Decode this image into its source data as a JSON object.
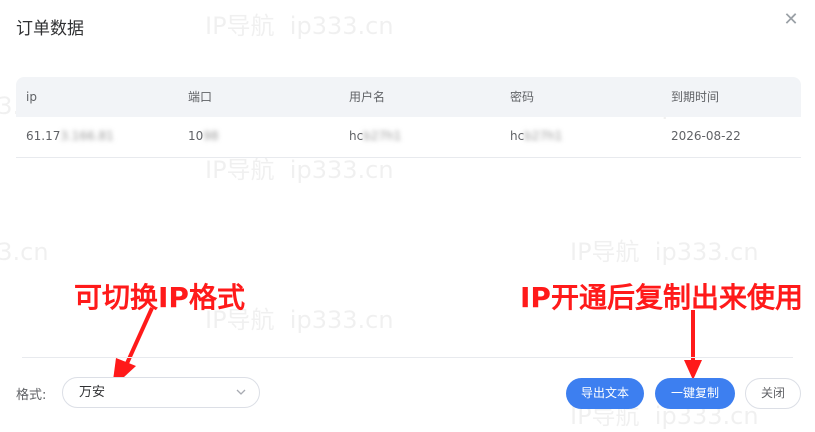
{
  "dialog": {
    "title": "订单数据",
    "close_icon": "close-icon"
  },
  "table": {
    "headers": [
      "ip",
      "端口",
      "用户名",
      "密码",
      "到期时间"
    ],
    "rows": [
      {
        "ip_visible": "61.17",
        "ip_blurred": "3.166.81",
        "port_visible": "10",
        "port_blurred": "98",
        "user_visible": "hc",
        "user_blurred": "b27h1",
        "pass_visible": "hc",
        "pass_blurred": "b27h1",
        "expiry": "2026-08-22"
      }
    ]
  },
  "watermark_text": "IP导航  ip333.cn",
  "annotations": {
    "left": "可切换IP格式",
    "right": "IP开通后复制出来使用",
    "color": "#ff1a1a"
  },
  "footer": {
    "format_label": "格式:",
    "format_value": "万安",
    "buttons": {
      "export": "导出文本",
      "copy": "一键复制",
      "close": "关闭"
    }
  },
  "colors": {
    "primary": "#3d7ff0",
    "annotation": "#ff1a1a"
  }
}
